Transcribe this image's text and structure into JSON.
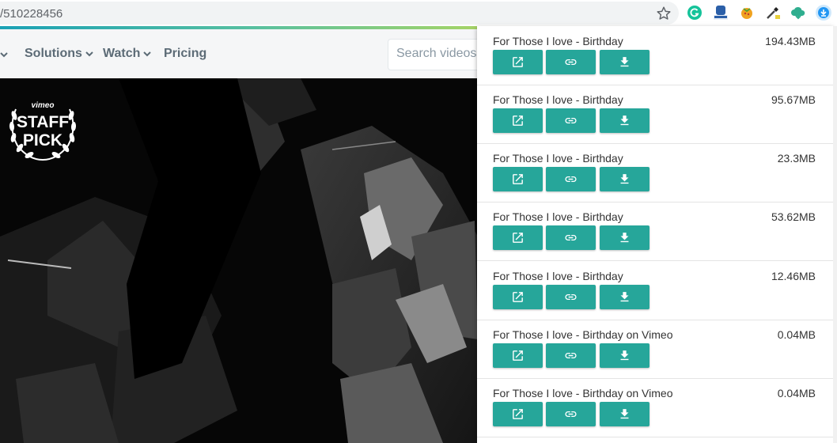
{
  "browser": {
    "url": "/510228456"
  },
  "nav": {
    "items": [
      {
        "label": "Solutions",
        "has_dropdown": true
      },
      {
        "label": "Watch",
        "has_dropdown": true
      },
      {
        "label": "Pricing",
        "has_dropdown": false
      }
    ],
    "search_placeholder": "Search videos"
  },
  "badge": {
    "brand": "vimeo",
    "line1": "STAFF",
    "line2": "PICK"
  },
  "popup": {
    "items": [
      {
        "title": "For Those I love - Birthday",
        "size": "194.43MB"
      },
      {
        "title": "For Those I love - Birthday",
        "size": "95.67MB"
      },
      {
        "title": "For Those I love - Birthday",
        "size": "23.3MB"
      },
      {
        "title": "For Those I love - Birthday",
        "size": "53.62MB"
      },
      {
        "title": "For Those I love - Birthday",
        "size": "12.46MB"
      },
      {
        "title": "For Those I love - Birthday on Vimeo",
        "size": "0.04MB"
      },
      {
        "title": "For Those I love - Birthday on Vimeo",
        "size": "0.04MB"
      }
    ],
    "button_icons": [
      "open-in-new-icon",
      "link-icon",
      "download-icon"
    ],
    "button_color": "#26a69a"
  },
  "colors": {
    "accent_bar": "#57c0a0",
    "nav_text": "#5c6b76"
  }
}
